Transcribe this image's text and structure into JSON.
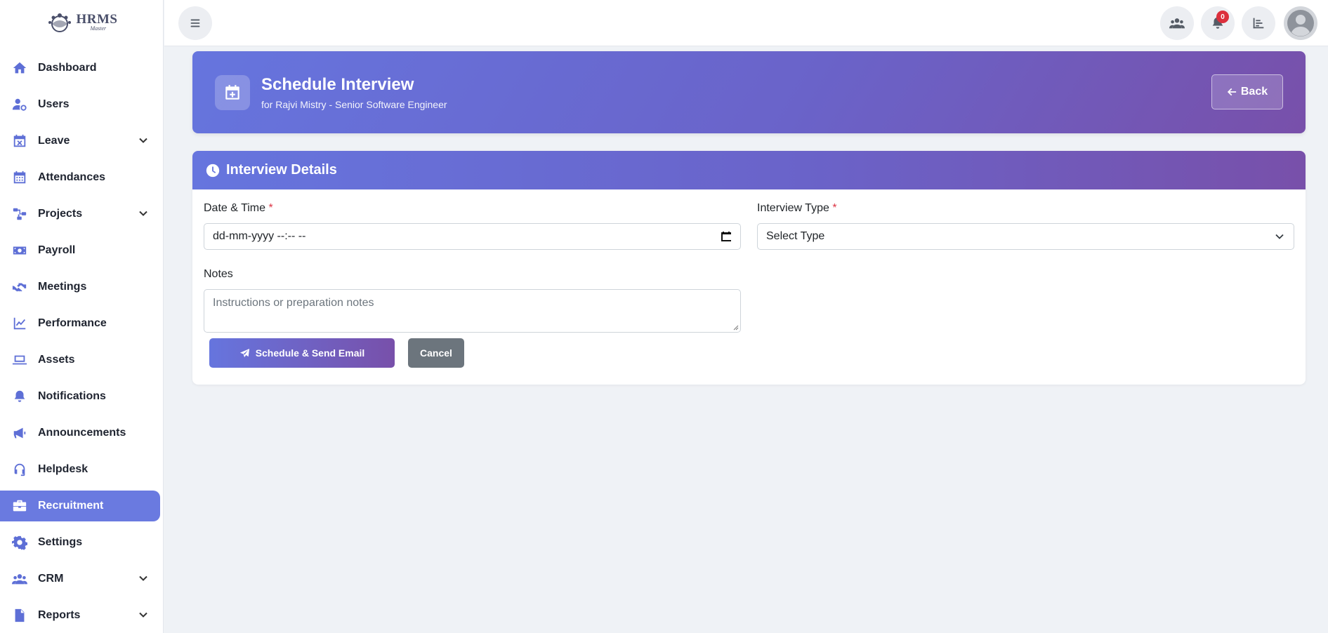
{
  "app": {
    "logo_title": "HRMS",
    "logo_subtitle": "Master"
  },
  "sidebar": {
    "items": [
      {
        "label": "Dashboard",
        "icon": "home-icon",
        "expandable": false,
        "active": false
      },
      {
        "label": "Users",
        "icon": "user-cog-icon",
        "expandable": false,
        "active": false
      },
      {
        "label": "Leave",
        "icon": "calendar-x-icon",
        "expandable": true,
        "active": false
      },
      {
        "label": "Attendances",
        "icon": "calendar-grid-icon",
        "expandable": false,
        "active": false
      },
      {
        "label": "Projects",
        "icon": "project-diagram-icon",
        "expandable": true,
        "active": false
      },
      {
        "label": "Payroll",
        "icon": "money-bill-icon",
        "expandable": false,
        "active": false
      },
      {
        "label": "Meetings",
        "icon": "handshake-icon",
        "expandable": false,
        "active": false
      },
      {
        "label": "Performance",
        "icon": "line-chart-icon",
        "expandable": false,
        "active": false
      },
      {
        "label": "Assets",
        "icon": "laptop-icon",
        "expandable": false,
        "active": false
      },
      {
        "label": "Notifications",
        "icon": "bell-icon",
        "expandable": false,
        "active": false
      },
      {
        "label": "Announcements",
        "icon": "megaphone-icon",
        "expandable": false,
        "active": false
      },
      {
        "label": "Helpdesk",
        "icon": "headset-icon",
        "expandable": false,
        "active": false
      },
      {
        "label": "Recruitment",
        "icon": "briefcase-icon",
        "expandable": false,
        "active": true
      },
      {
        "label": "Settings",
        "icon": "gear-icon",
        "expandable": false,
        "active": false
      },
      {
        "label": "CRM",
        "icon": "users-icon",
        "expandable": true,
        "active": false
      },
      {
        "label": "Reports",
        "icon": "file-icon",
        "expandable": true,
        "active": false
      }
    ]
  },
  "topbar": {
    "notification_count": "0"
  },
  "header": {
    "title": "Schedule Interview",
    "subtitle": "for Rajvi Mistry - Senior Software Engineer",
    "back_label": "Back"
  },
  "form": {
    "section_title": "Interview Details",
    "datetime_label": "Date & Time",
    "datetime_value": "dd-mm-yyyy --:-- --",
    "type_label": "Interview Type",
    "type_value": "Select Type",
    "notes_label": "Notes",
    "notes_placeholder": "Instructions or preparation notes",
    "required_mark": "*",
    "submit_label": "Schedule & Send Email",
    "cancel_label": "Cancel"
  },
  "colors": {
    "accent": "#6a7ae0",
    "gradient_start": "#6675de",
    "gradient_end": "#7850aa",
    "badge": "#dc2f3c",
    "cancel": "#6c757d"
  }
}
